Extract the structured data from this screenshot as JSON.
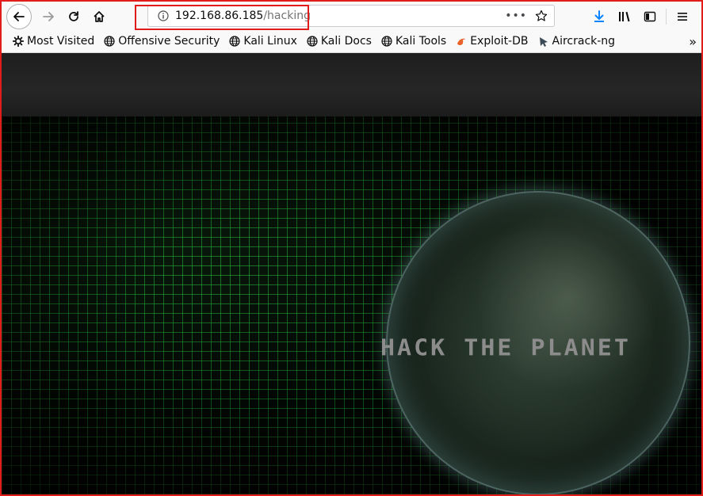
{
  "browser": {
    "url_host": "192.168.86.185",
    "url_path": "/hacking",
    "nav": {
      "back_icon": "back-arrow-icon",
      "forward_icon": "forward-arrow-icon",
      "reload_icon": "reload-icon",
      "home_icon": "home-icon"
    },
    "toolbar_icons": [
      "download-icon",
      "library-icon",
      "sidebar-icon",
      "menu-icon"
    ]
  },
  "bookmarks": [
    {
      "label": "Most Visited",
      "icon": "gear-icon"
    },
    {
      "label": "Offensive Security",
      "icon": "globe-icon"
    },
    {
      "label": "Kali Linux",
      "icon": "globe-icon"
    },
    {
      "label": "Kali Docs",
      "icon": "globe-icon"
    },
    {
      "label": "Kali Tools",
      "icon": "globe-icon"
    },
    {
      "label": "Exploit-DB",
      "icon": "exploit-db-icon"
    },
    {
      "label": "Aircrack-ng",
      "icon": "aircrack-icon"
    }
  ],
  "page": {
    "slogan": "HACK THE PLANET"
  },
  "colors": {
    "highlight": "#e21b1b",
    "grid": "#28c83c",
    "download_accent": "#0a84ff"
  }
}
